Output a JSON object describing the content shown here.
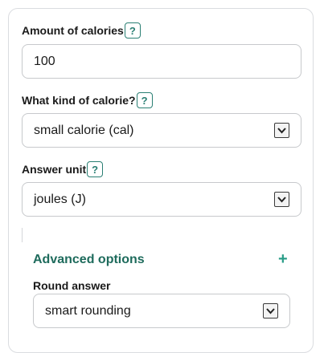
{
  "fields": {
    "amount": {
      "label": "Amount of calories",
      "help": "?",
      "value": "100"
    },
    "calorie_kind": {
      "label": "What kind of calorie?",
      "help": "?",
      "selected": "small calorie (cal)"
    },
    "answer_unit": {
      "label": "Answer unit",
      "help": "?",
      "selected": "joules (J)"
    }
  },
  "advanced": {
    "title": "Advanced options",
    "toggle": "+",
    "round_label": "Round answer",
    "round_selected": "smart rounding"
  },
  "colors": {
    "accent": "#1e6b5c",
    "help_border": "#2a7f73",
    "plus": "#2a9d88"
  }
}
